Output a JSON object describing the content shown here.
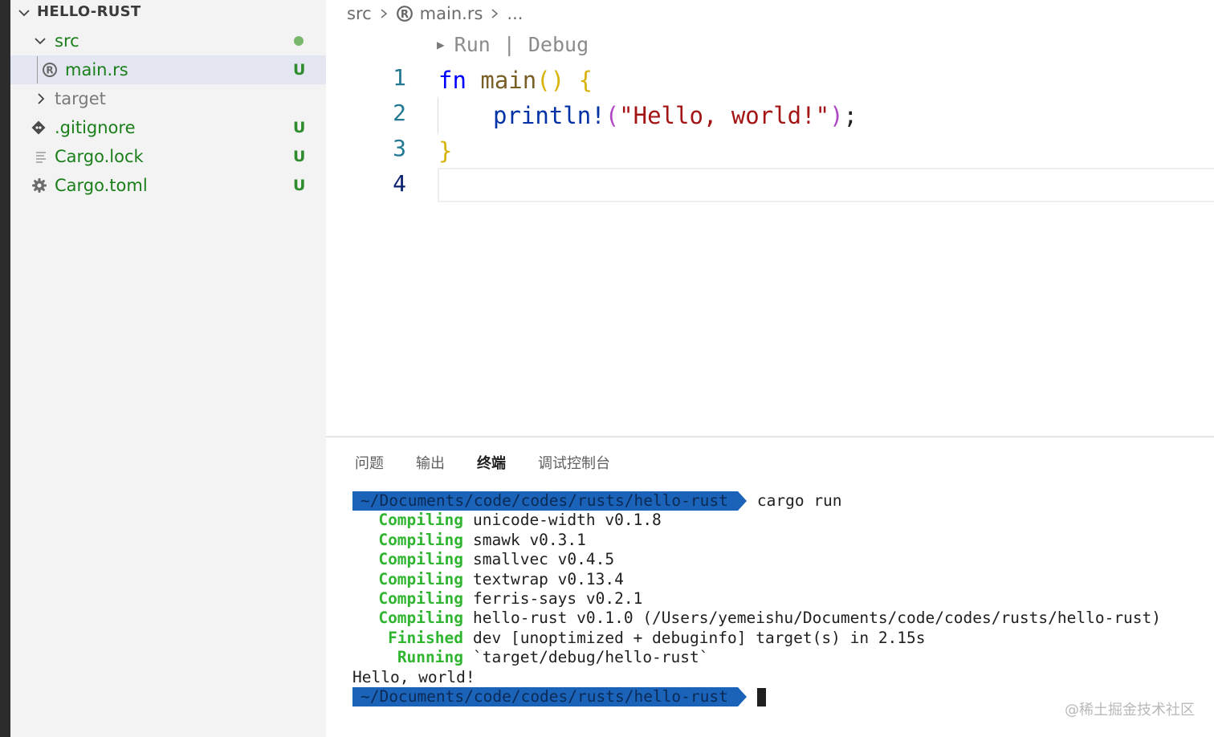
{
  "explorer": {
    "title": "HELLO-RUST",
    "items": [
      {
        "label": "src",
        "badge": "",
        "icon": "folder-open-chevron"
      },
      {
        "label": "main.rs",
        "badge": "U",
        "icon": "rust-file-icon"
      },
      {
        "label": "target",
        "badge": "",
        "icon": "folder-closed-chevron"
      },
      {
        "label": ".gitignore",
        "badge": "U",
        "icon": "git-icon"
      },
      {
        "label": "Cargo.lock",
        "badge": "U",
        "icon": "lines-icon"
      },
      {
        "label": "Cargo.toml",
        "badge": "U",
        "icon": "gear-icon"
      }
    ],
    "modified_dot_color": "#79b86c"
  },
  "breadcrumb": {
    "folder": "src",
    "file": "main.rs",
    "more": "..."
  },
  "codelens": {
    "run": "Run",
    "sep": "|",
    "debug": "Debug"
  },
  "editor": {
    "line_numbers": [
      "1",
      "2",
      "3",
      "4"
    ],
    "line1": {
      "kw": "fn",
      "name": "main",
      "parens": "()",
      "brace": "{"
    },
    "line2": {
      "macro": "println!",
      "open": "(",
      "string": "\"Hello, world!\"",
      "close": ")",
      "semi": ";"
    },
    "line3": {
      "brace": "}"
    }
  },
  "panel": {
    "tabs": [
      "问题",
      "输出",
      "终端",
      "调试控制台"
    ],
    "active_tab": "终端"
  },
  "terminal": {
    "prompt_path": "~/Documents/code/codes/rusts/hello-rust",
    "command": "cargo run",
    "lines": [
      {
        "status": "Compiling",
        "text": "unicode-width v0.1.8"
      },
      {
        "status": "Compiling",
        "text": "smawk v0.3.1"
      },
      {
        "status": "Compiling",
        "text": "smallvec v0.4.5"
      },
      {
        "status": "Compiling",
        "text": "textwrap v0.13.4"
      },
      {
        "status": "Compiling",
        "text": "ferris-says v0.2.1"
      },
      {
        "status": "Compiling",
        "text": "hello-rust v0.1.0 (/Users/yemeishu/Documents/code/codes/rusts/hello-rust)"
      },
      {
        "status": "Finished",
        "text": "dev [unoptimized + debuginfo] target(s) in 2.15s"
      },
      {
        "status": "Running",
        "text": "`target/debug/hello-rust`"
      }
    ],
    "output": "Hello, world!",
    "prompt_color": "#1a63b8",
    "status_color": "#2fb52f"
  },
  "watermark": "@稀土掘金技术社区"
}
